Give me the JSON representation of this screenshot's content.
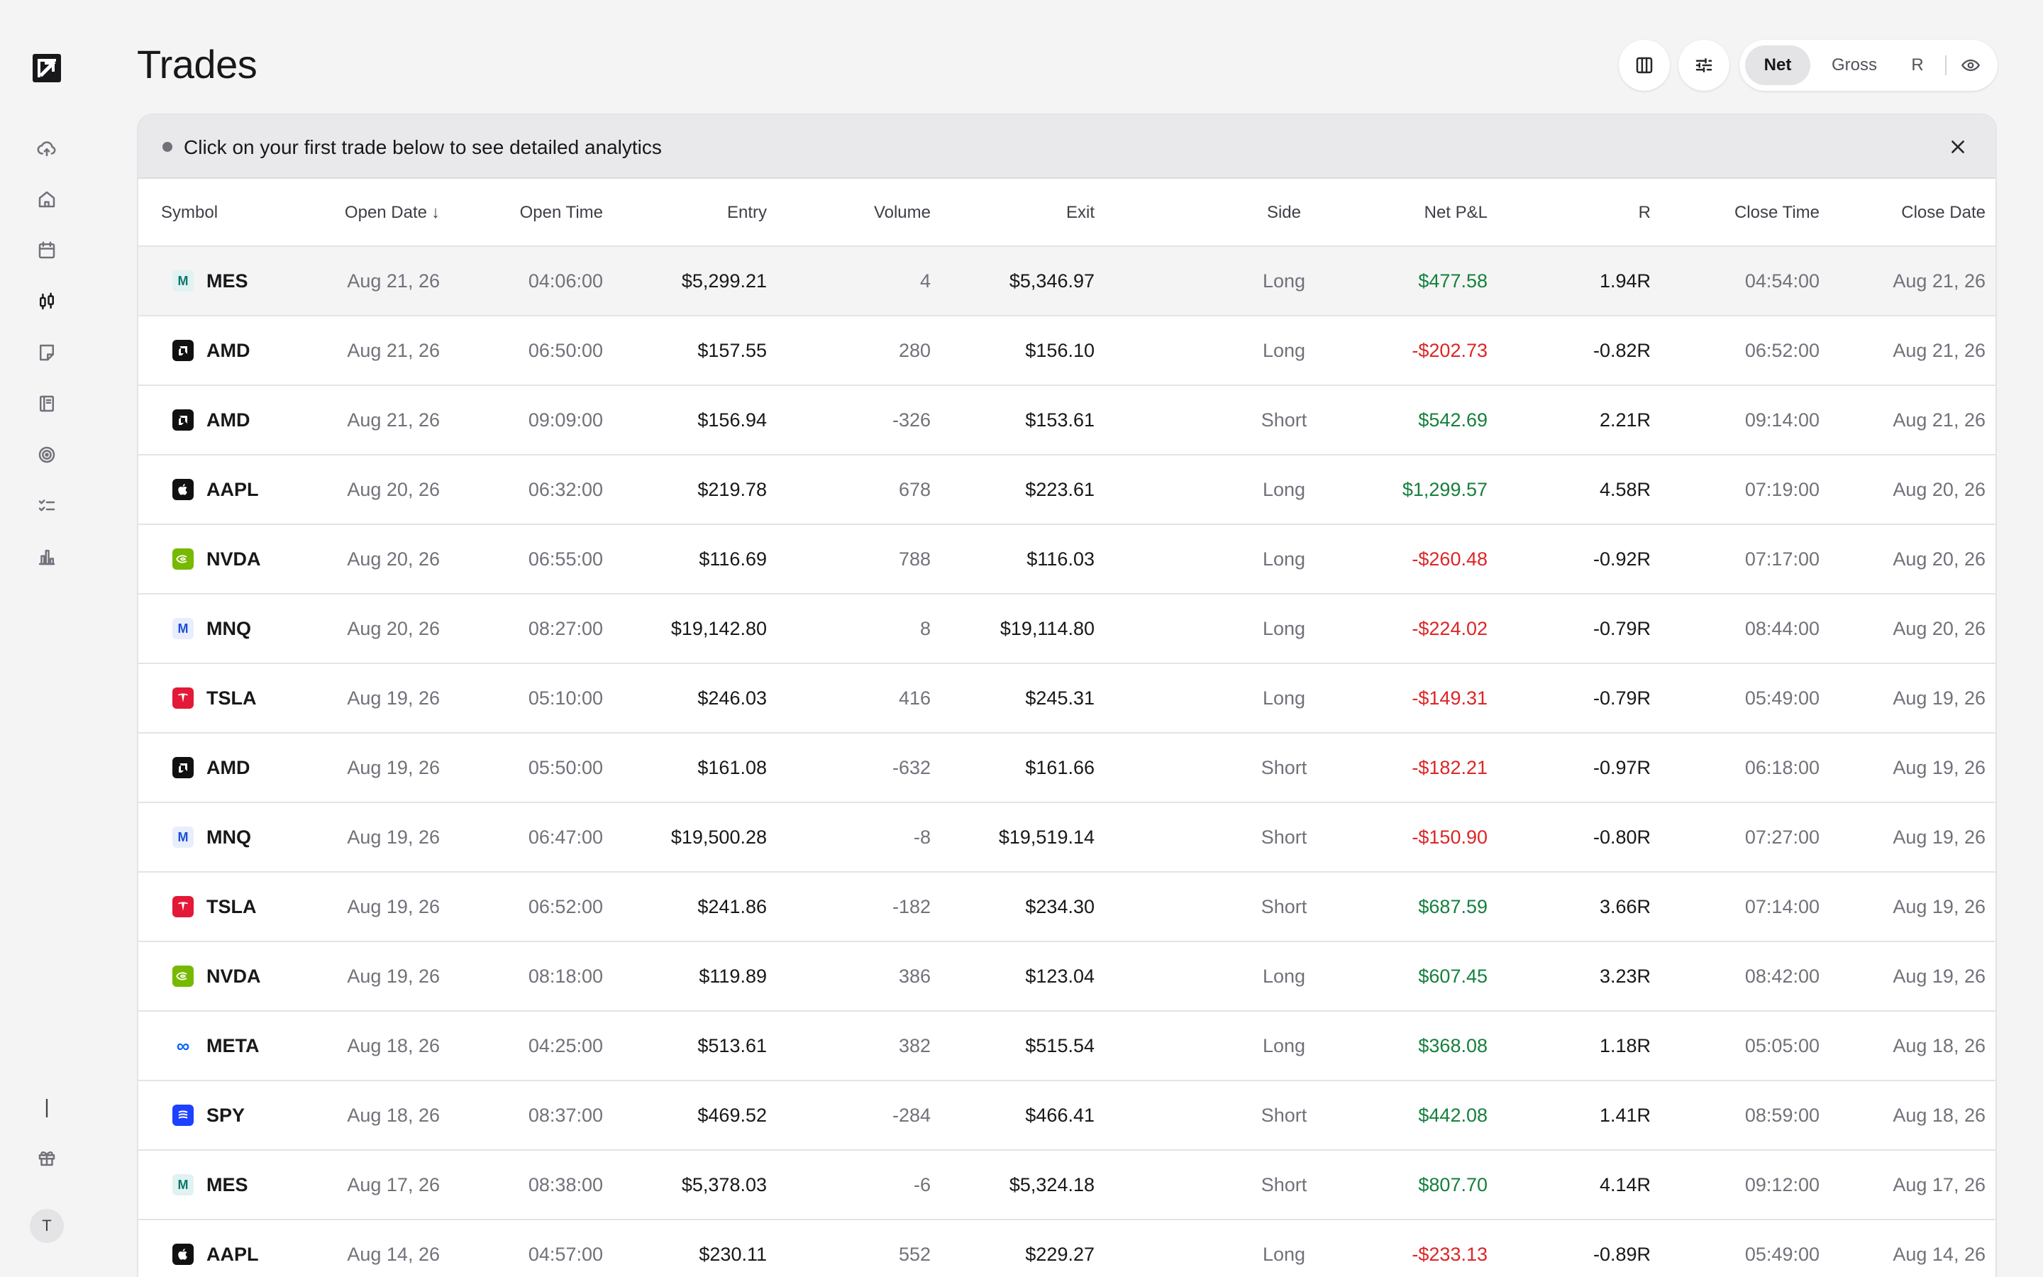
{
  "page": {
    "title": "Trades"
  },
  "sidebar": {
    "items": [
      {
        "name": "upload",
        "icon": "cloud-upload-icon"
      },
      {
        "name": "home",
        "icon": "home-icon"
      },
      {
        "name": "calendar",
        "icon": "calendar-icon"
      },
      {
        "name": "trades",
        "icon": "candlestick-icon",
        "active": true
      },
      {
        "name": "notes",
        "icon": "note-icon"
      },
      {
        "name": "playbook",
        "icon": "book-icon"
      },
      {
        "name": "goals",
        "icon": "target-icon"
      },
      {
        "name": "checklist",
        "icon": "checklist-icon"
      },
      {
        "name": "reports",
        "icon": "bar-chart-icon"
      }
    ],
    "bottom": {
      "divider_glyph": "|",
      "gift_icon": "gift-icon",
      "avatar_initial": "T"
    }
  },
  "header": {
    "columns_icon": "columns-icon",
    "filters_icon": "sliders-icon",
    "toggle": {
      "options": [
        "Net",
        "Gross",
        "R"
      ],
      "selected": "Net"
    },
    "visibility_icon": "eye-icon"
  },
  "banner": {
    "text": "Click on your first trade below to see detailed analytics",
    "close_icon": "close-icon"
  },
  "table": {
    "columns": [
      "Symbol",
      "Open Date",
      "Open Time",
      "Entry",
      "Volume",
      "Exit",
      "Side",
      "Net P&L",
      "R",
      "Close Time",
      "Close Date"
    ],
    "sorted_column": "Open Date",
    "sort_direction": "desc",
    "rows": [
      {
        "symbol": "MES",
        "icon": "M",
        "icon_kind": "mes",
        "open_date": "Aug 21, 26",
        "open_time": "04:06:00",
        "entry": "$5,299.21",
        "volume": "4",
        "exit": "$5,346.97",
        "side": "Long",
        "pnl": "$477.58",
        "pnl_sign": "pos",
        "r": "1.94R",
        "close_time": "04:54:00",
        "close_date": "Aug 21, 26"
      },
      {
        "symbol": "AMD",
        "icon": "a",
        "icon_kind": "amd",
        "open_date": "Aug 21, 26",
        "open_time": "06:50:00",
        "entry": "$157.55",
        "volume": "280",
        "exit": "$156.10",
        "side": "Long",
        "pnl": "-$202.73",
        "pnl_sign": "neg",
        "r": "-0.82R",
        "close_time": "06:52:00",
        "close_date": "Aug 21, 26"
      },
      {
        "symbol": "AMD",
        "icon": "a",
        "icon_kind": "amd",
        "open_date": "Aug 21, 26",
        "open_time": "09:09:00",
        "entry": "$156.94",
        "volume": "-326",
        "exit": "$153.61",
        "side": "Short",
        "pnl": "$542.69",
        "pnl_sign": "pos",
        "r": "2.21R",
        "close_time": "09:14:00",
        "close_date": "Aug 21, 26"
      },
      {
        "symbol": "AAPL",
        "icon": "",
        "icon_kind": "aapl",
        "open_date": "Aug 20, 26",
        "open_time": "06:32:00",
        "entry": "$219.78",
        "volume": "678",
        "exit": "$223.61",
        "side": "Long",
        "pnl": "$1,299.57",
        "pnl_sign": "pos",
        "r": "4.58R",
        "close_time": "07:19:00",
        "close_date": "Aug 20, 26"
      },
      {
        "symbol": "NVDA",
        "icon": "",
        "icon_kind": "nvda",
        "open_date": "Aug 20, 26",
        "open_time": "06:55:00",
        "entry": "$116.69",
        "volume": "788",
        "exit": "$116.03",
        "side": "Long",
        "pnl": "-$260.48",
        "pnl_sign": "neg",
        "r": "-0.92R",
        "close_time": "07:17:00",
        "close_date": "Aug 20, 26"
      },
      {
        "symbol": "MNQ",
        "icon": "M",
        "icon_kind": "mnq",
        "open_date": "Aug 20, 26",
        "open_time": "08:27:00",
        "entry": "$19,142.80",
        "volume": "8",
        "exit": "$19,114.80",
        "side": "Long",
        "pnl": "-$224.02",
        "pnl_sign": "neg",
        "r": "-0.79R",
        "close_time": "08:44:00",
        "close_date": "Aug 20, 26"
      },
      {
        "symbol": "TSLA",
        "icon": "T",
        "icon_kind": "tsla",
        "open_date": "Aug 19, 26",
        "open_time": "05:10:00",
        "entry": "$246.03",
        "volume": "416",
        "exit": "$245.31",
        "side": "Long",
        "pnl": "-$149.31",
        "pnl_sign": "neg",
        "r": "-0.79R",
        "close_time": "05:49:00",
        "close_date": "Aug 19, 26"
      },
      {
        "symbol": "AMD",
        "icon": "a",
        "icon_kind": "amd",
        "open_date": "Aug 19, 26",
        "open_time": "05:50:00",
        "entry": "$161.08",
        "volume": "-632",
        "exit": "$161.66",
        "side": "Short",
        "pnl": "-$182.21",
        "pnl_sign": "neg",
        "r": "-0.97R",
        "close_time": "06:18:00",
        "close_date": "Aug 19, 26"
      },
      {
        "symbol": "MNQ",
        "icon": "M",
        "icon_kind": "mnq",
        "open_date": "Aug 19, 26",
        "open_time": "06:47:00",
        "entry": "$19,500.28",
        "volume": "-8",
        "exit": "$19,519.14",
        "side": "Short",
        "pnl": "-$150.90",
        "pnl_sign": "neg",
        "r": "-0.80R",
        "close_time": "07:27:00",
        "close_date": "Aug 19, 26"
      },
      {
        "symbol": "TSLA",
        "icon": "T",
        "icon_kind": "tsla",
        "open_date": "Aug 19, 26",
        "open_time": "06:52:00",
        "entry": "$241.86",
        "volume": "-182",
        "exit": "$234.30",
        "side": "Short",
        "pnl": "$687.59",
        "pnl_sign": "pos",
        "r": "3.66R",
        "close_time": "07:14:00",
        "close_date": "Aug 19, 26"
      },
      {
        "symbol": "NVDA",
        "icon": "",
        "icon_kind": "nvda",
        "open_date": "Aug 19, 26",
        "open_time": "08:18:00",
        "entry": "$119.89",
        "volume": "386",
        "exit": "$123.04",
        "side": "Long",
        "pnl": "$607.45",
        "pnl_sign": "pos",
        "r": "3.23R",
        "close_time": "08:42:00",
        "close_date": "Aug 19, 26"
      },
      {
        "symbol": "META",
        "icon": "∞",
        "icon_kind": "meta",
        "open_date": "Aug 18, 26",
        "open_time": "04:25:00",
        "entry": "$513.61",
        "volume": "382",
        "exit": "$515.54",
        "side": "Long",
        "pnl": "$368.08",
        "pnl_sign": "pos",
        "r": "1.18R",
        "close_time": "05:05:00",
        "close_date": "Aug 18, 26"
      },
      {
        "symbol": "SPY",
        "icon": "",
        "icon_kind": "spy",
        "open_date": "Aug 18, 26",
        "open_time": "08:37:00",
        "entry": "$469.52",
        "volume": "-284",
        "exit": "$466.41",
        "side": "Short",
        "pnl": "$442.08",
        "pnl_sign": "pos",
        "r": "1.41R",
        "close_time": "08:59:00",
        "close_date": "Aug 18, 26"
      },
      {
        "symbol": "MES",
        "icon": "M",
        "icon_kind": "mes",
        "open_date": "Aug 17, 26",
        "open_time": "08:38:00",
        "entry": "$5,378.03",
        "volume": "-6",
        "exit": "$5,324.18",
        "side": "Short",
        "pnl": "$807.70",
        "pnl_sign": "pos",
        "r": "4.14R",
        "close_time": "09:12:00",
        "close_date": "Aug 17, 26"
      },
      {
        "symbol": "AAPL",
        "icon": "",
        "icon_kind": "aapl",
        "open_date": "Aug 14, 26",
        "open_time": "04:57:00",
        "entry": "$230.11",
        "volume": "552",
        "exit": "$229.27",
        "side": "Long",
        "pnl": "-$233.13",
        "pnl_sign": "neg",
        "r": "-0.89R",
        "close_time": "05:49:00",
        "close_date": "Aug 14, 26"
      }
    ]
  },
  "colors": {
    "positive": "#15803d",
    "negative": "#dc2626",
    "background": "#f4f4f5",
    "card": "#ffffff",
    "banner": "#e9e9eb"
  }
}
